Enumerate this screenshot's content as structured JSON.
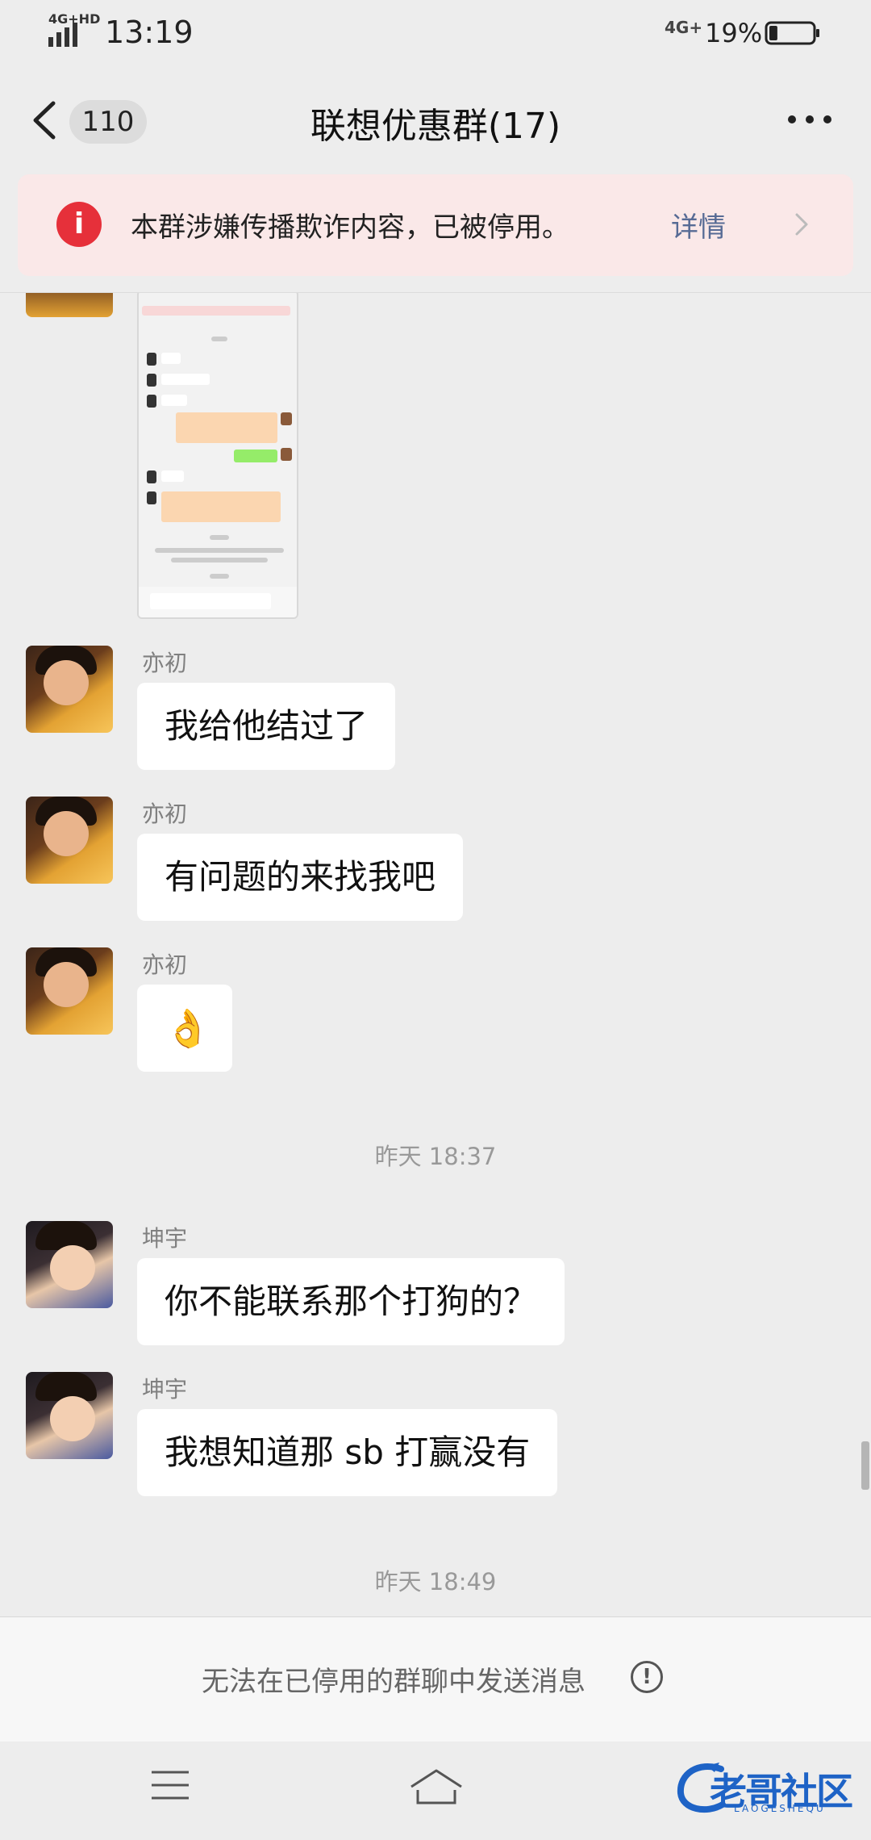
{
  "status_bar": {
    "network_hd": "4G+HD",
    "time": "13:19",
    "network": "4G+",
    "battery_percent": "19%",
    "battery_level": 0.19
  },
  "header": {
    "back_icon": "chevron-left-icon",
    "unread_count": "110",
    "title": "联想优惠群(17)",
    "more_icon": "more-dots-icon"
  },
  "warning": {
    "icon": "info-alert-icon",
    "icon_glyph": "i",
    "text": "本群涉嫌传播欺诈内容，已被停用。",
    "detail_label": "详情",
    "accent_color": "#e6303a",
    "link_color": "#576b95"
  },
  "messages": [
    {
      "sender": "亦初",
      "text": "我给他结过了"
    },
    {
      "sender": "亦初",
      "text": "有问题的来找我吧"
    },
    {
      "sender": "亦初",
      "text": "👌",
      "emoji_name": "ok-hand-emoji"
    },
    {
      "timestamp": "昨天 18:37"
    },
    {
      "sender": "坤宇",
      "text": "你不能联系那个打狗的？"
    },
    {
      "sender": "坤宇",
      "text": "我想知道那 sb 打赢没有"
    },
    {
      "timestamp": "昨天 18:49"
    }
  ],
  "input_bar": {
    "disabled_message": "无法在已停用的群聊中发送消息",
    "info_icon_glyph": "!"
  },
  "nav_bar": {
    "menu_icon": "menu-icon",
    "home_icon": "home-icon"
  },
  "watermark": {
    "text": "老哥社区",
    "subtext": "LAOGESHEQU"
  }
}
